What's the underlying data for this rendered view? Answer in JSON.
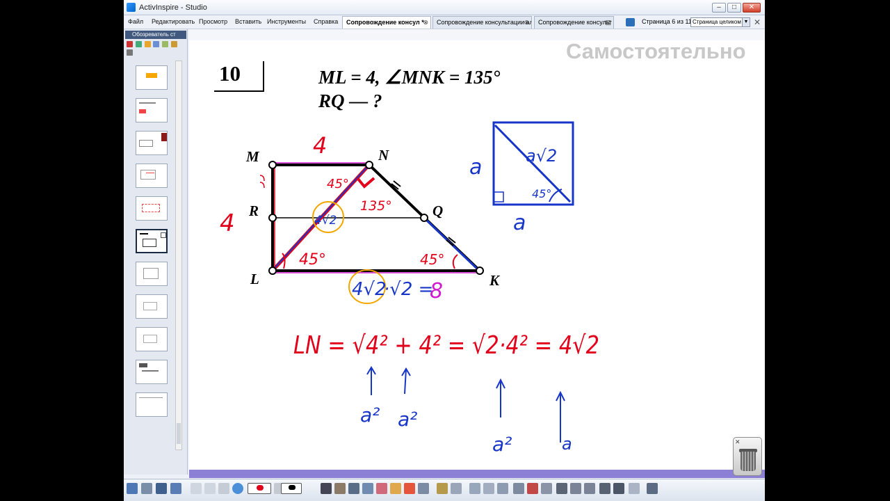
{
  "window": {
    "title": "ActivInspire - Studio"
  },
  "menu": {
    "items": [
      "Файл",
      "Редактировать",
      "Просмотр",
      "Вставить",
      "Инструменты",
      "Справка"
    ]
  },
  "tabs": [
    {
      "label": "Сопровождение консул *",
      "active": true
    },
    {
      "label": "Сопровождение консультации ал",
      "active": false
    },
    {
      "label": "Сопровождение консульт",
      "active": false
    }
  ],
  "page_info": {
    "label": "Страница 6 из 11",
    "zoom": "Страница целиком"
  },
  "browser": {
    "title": "Обозреватель ст",
    "active_thumb": 6,
    "thumb_count": 11
  },
  "slide": {
    "heading": "Самостоятельно",
    "problem_number": "10",
    "given_line1": "ML = 4, ∠MNK = 135°",
    "given_line2": "RQ — ?",
    "vertices": {
      "M": "M",
      "N": "N",
      "R": "R",
      "Q": "Q",
      "L": "L",
      "K": "K"
    },
    "annotations": {
      "mn_len": "4",
      "ml_len": "4",
      "angle_n_left": "45°",
      "angle_n": "135°",
      "diag": "4√2",
      "angle_l": "45°",
      "angle_k": "45°",
      "lk_expr_a": "4√2",
      "lk_expr_b": "·√2 =",
      "lk_result": "8",
      "sq_a_left": "a",
      "sq_diag": "a√2",
      "sq_angle": "45°",
      "sq_a_bottom": "a",
      "formula": "LN = √4² + 4² = √2·4² = 4√2",
      "arrow_labels": [
        "a²",
        "a²",
        "a²",
        "a"
      ]
    }
  },
  "colors": {
    "red": "#e3001b",
    "blue": "#1736c8",
    "orange": "#f2a800",
    "magenta": "#d21bd0",
    "purple_bar": "#8b7fd6"
  },
  "icons": [
    "app-icon",
    "minimize-icon",
    "maximize-icon",
    "close-icon",
    "trash-icon"
  ]
}
